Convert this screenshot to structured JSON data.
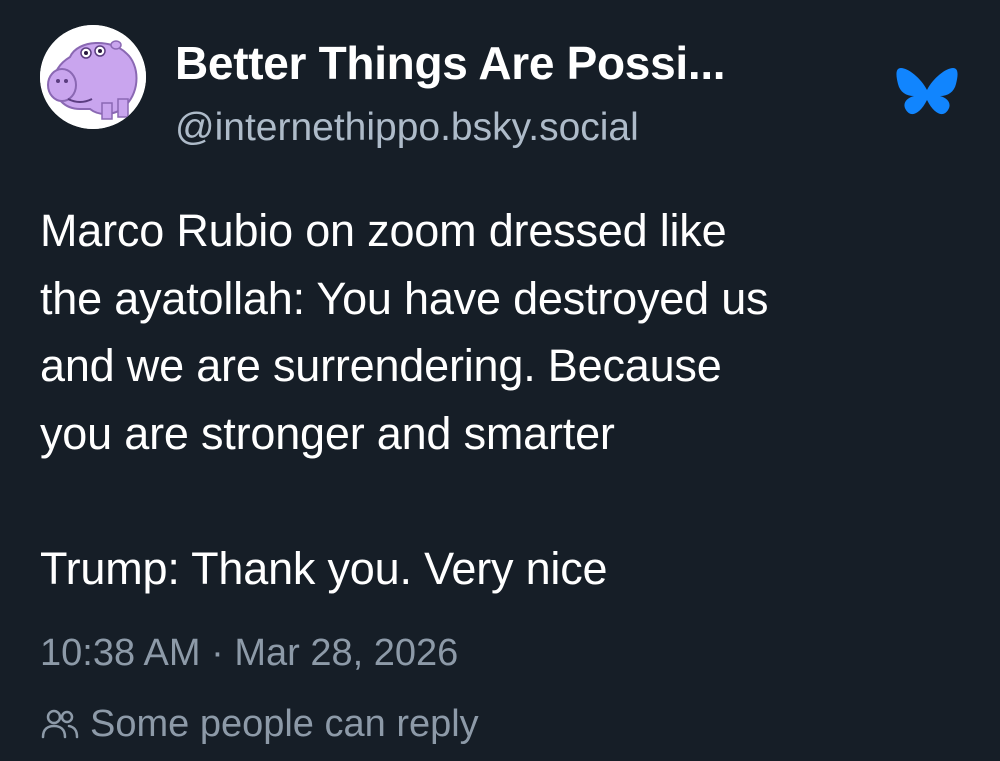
{
  "author": {
    "display_name": "Better Things Are Possi...",
    "handle": "@internethippo.bsky.social",
    "avatar_icon": "hippo-avatar",
    "avatar_color": "#c9a5ee"
  },
  "brand": {
    "logo_icon": "bluesky-butterfly-icon",
    "logo_color": "#1185fe"
  },
  "post": {
    "lines": [
      "Marco Rubio on zoom dressed like",
      "the ayatollah: You have destroyed us",
      "and we are surrendering. Because",
      "you are stronger and smarter"
    ],
    "reply_line": "Trump: Thank you. Very nice"
  },
  "meta": {
    "timestamp": "10:38 AM · Mar 28, 2026",
    "reply_setting_icon": "people-icon",
    "reply_setting_label": "Some people can reply"
  },
  "colors": {
    "background": "#161e27",
    "text": "#ffffff",
    "muted": "#8d9aa8",
    "handle": "#aebbc9"
  }
}
